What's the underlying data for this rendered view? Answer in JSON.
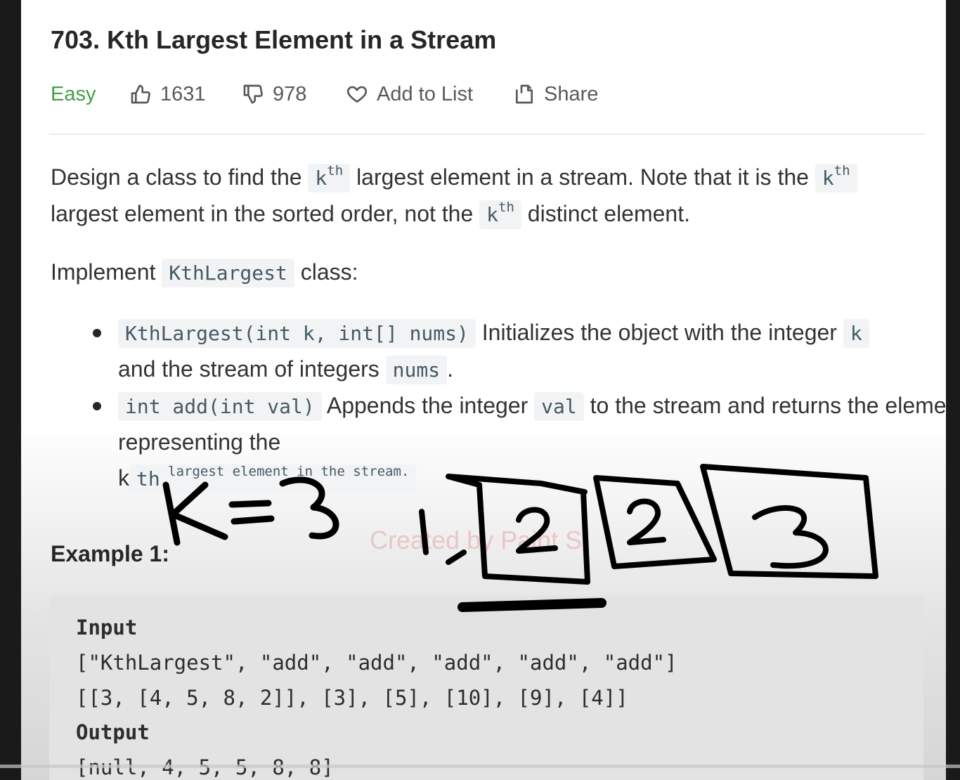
{
  "problem": {
    "title": "703. Kth Largest Element in a Stream",
    "difficulty": "Easy",
    "likes": "1631",
    "dislikes": "978",
    "add_to_list": "Add to List",
    "share": "Share"
  },
  "description": {
    "p1": [
      "Design a class to find the ",
      "k",
      "th",
      " largest element in a stream. Note that it is the ",
      "k",
      "th",
      " largest element in the sorted order, not the ",
      "k",
      "th",
      " distinct element."
    ],
    "p2": [
      "Implement ",
      "KthLargest",
      " class:"
    ],
    "bullet1": [
      "KthLargest(int k, int[] nums)",
      " Initializes the object with the integer ",
      "k",
      " and the stream of integers ",
      "nums",
      "."
    ],
    "bullet2": [
      "int add(int val)",
      " Appends the integer ",
      "val",
      " to the stream and returns the element representing the ",
      "k",
      "th",
      " largest element in the stream."
    ]
  },
  "example": {
    "heading": "Example 1:",
    "input_label": "Input",
    "input_line1": "[\"KthLargest\", \"add\", \"add\", \"add\", \"add\", \"add\"]",
    "input_line2": "[[3, [4, 5, 8, 2]], [3], [5], [10], [9], [4]]",
    "output_label": "Output",
    "output_line1": "[null, 4, 5, 5, 8, 8]"
  },
  "annotation": {
    "k_label": "K=3",
    "sequence": [
      "1",
      "2",
      "2",
      "3"
    ]
  },
  "watermark": "Created by Paint S",
  "icons": {
    "like": "thumbs-up-icon",
    "dislike": "thumbs-down-icon",
    "favorite": "heart-icon",
    "share": "share-icon"
  },
  "colors": {
    "difficulty_easy": "#43a047",
    "ink": "#000000"
  }
}
